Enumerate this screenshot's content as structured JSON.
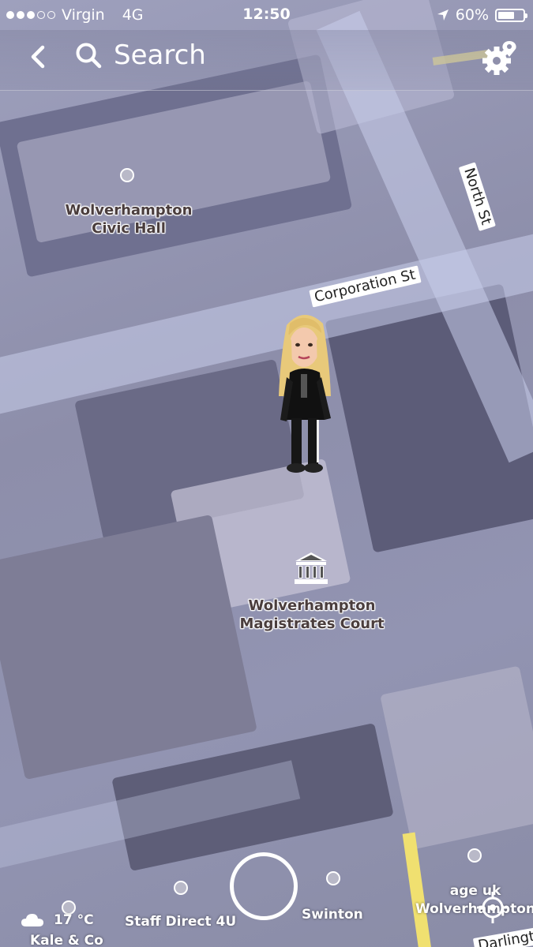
{
  "status_bar": {
    "carrier": "Virgin",
    "network": "4G",
    "time": "12:50",
    "battery": "60%",
    "signal_bars": 3,
    "signal_bars_total": 5,
    "battery_level": 0.6
  },
  "header": {
    "search_label": "Search"
  },
  "map": {
    "places": [
      {
        "name": "Wolverhampton\nCivic Hall"
      },
      {
        "name": "Wolverhampton\nMagistrates Court"
      },
      {
        "name": "Staff Direct 4U"
      },
      {
        "name": "Swinton"
      },
      {
        "name": "age uk\nWolverhampton"
      },
      {
        "name": "Kale & Co"
      }
    ],
    "streets": [
      "Corporation St",
      "North St",
      "Darlington"
    ]
  },
  "weather": {
    "temperature": "17 °C"
  },
  "colors": {
    "label_text": "#4a3d3d",
    "map_base": "#8f90ab"
  }
}
